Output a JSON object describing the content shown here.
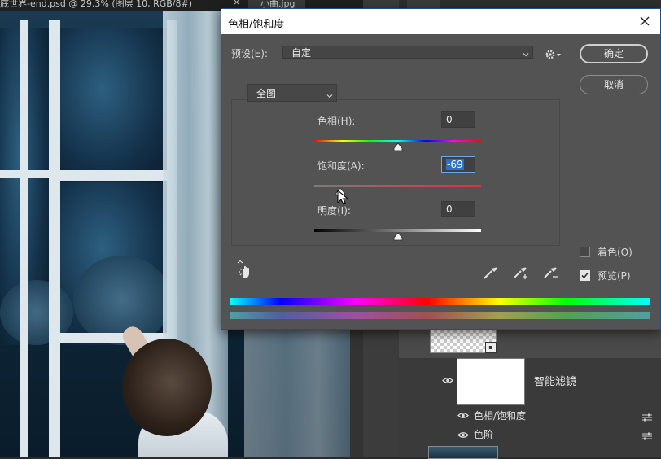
{
  "document": {
    "tab_title": "底世界-end.psd @ 29.3% (图层 10, RGB/8#)",
    "tab_close": "×",
    "second_tab": "小曲.jpg"
  },
  "layers_panel": {
    "smart_filter_label": "智能滤镜",
    "filters": [
      {
        "label": "色相/饱和度"
      },
      {
        "label": "色阶"
      }
    ]
  },
  "dialog": {
    "title": "色相/饱和度",
    "close_glyph": "✕",
    "preset_label": "预设(E):",
    "preset_value": "自定",
    "ok_label": "确定",
    "cancel_label": "取消",
    "channel_value": "全图",
    "sliders": [
      {
        "label": "色相(H):",
        "value": "0",
        "position": 0.5
      },
      {
        "label": "饱和度(A):",
        "value": "-69",
        "position": 0.155
      },
      {
        "label": "明度(I):",
        "value": "0",
        "position": 0.5
      }
    ],
    "colorize_label": "着色(O)",
    "colorize_checked": false,
    "preview_label": "预览(P)",
    "preview_checked": true
  },
  "colors": {
    "dialog_bg": "#535353",
    "accent_selection": "#2b6fd0",
    "titlebar": "#ffffff"
  },
  "icons": [
    "close-icon",
    "chevron-down-icon",
    "gear-icon",
    "hand-adjust-icon",
    "eyedropper-icon",
    "eyedropper-plus-icon",
    "eyedropper-minus-icon",
    "eye-icon",
    "filter-options-icon",
    "cursor-icon"
  ]
}
